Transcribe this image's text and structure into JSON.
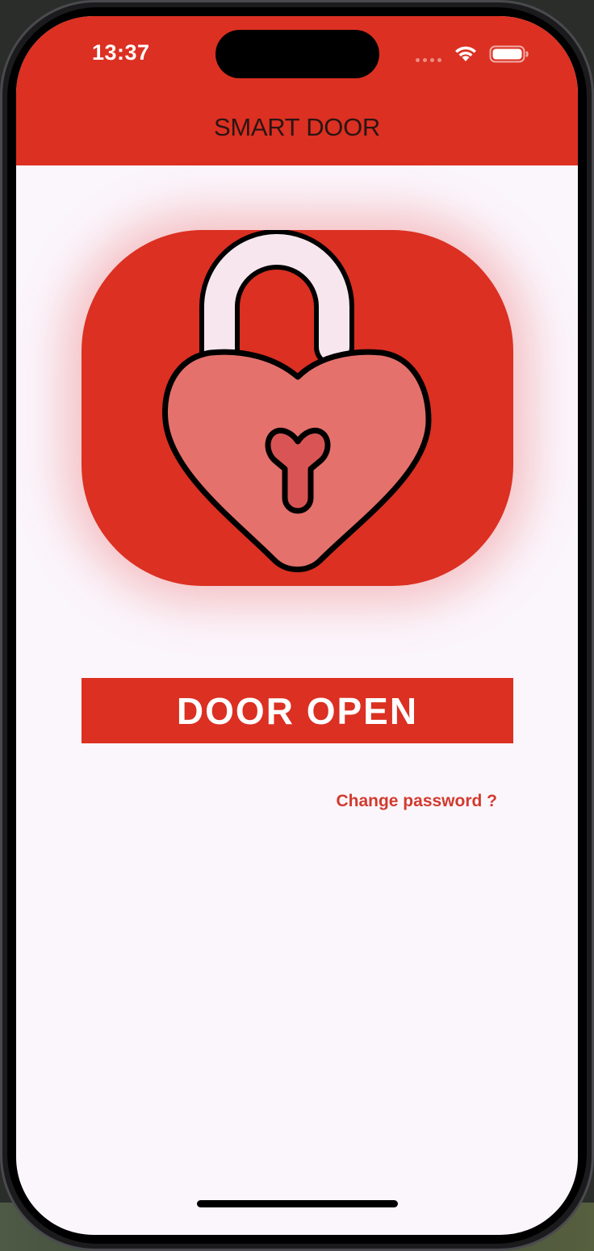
{
  "status_bar": {
    "time": "13:37",
    "icons": [
      "signal-dots-icon",
      "wifi-icon",
      "battery-icon"
    ]
  },
  "header": {
    "title": "SMART DOOR",
    "background": "#dc3022"
  },
  "lock": {
    "icon": "heart-padlock-unlocked-icon",
    "card_color": "#db3022",
    "heart_color": "#e5716c",
    "keyhole_color": "#d95555",
    "shackle_color": "#f7e6ee"
  },
  "status": {
    "label": "DOOR OPEN",
    "color": "#db3022"
  },
  "links": {
    "change_password": "Change password ?"
  },
  "colors": {
    "accent": "#dc3022",
    "background": "#fbf6fc",
    "link": "#d23a2e"
  }
}
